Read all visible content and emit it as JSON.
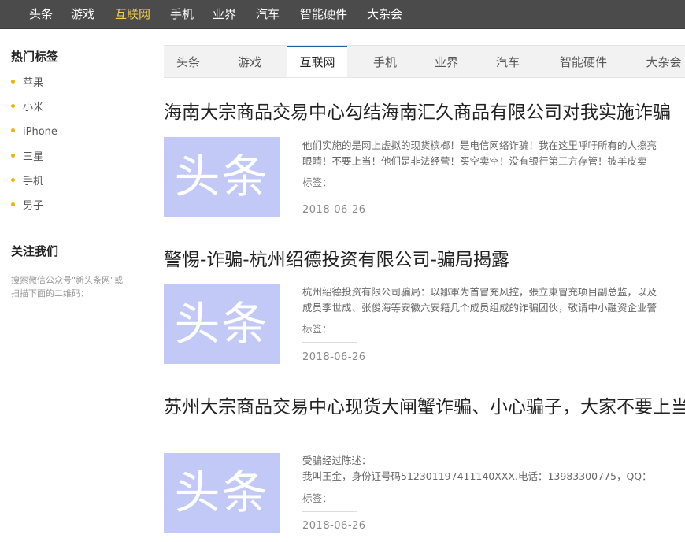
{
  "top_nav": [
    {
      "label": "头条"
    },
    {
      "label": "游戏"
    },
    {
      "label": "互联网",
      "active": true
    },
    {
      "label": "手机"
    },
    {
      "label": "业界"
    },
    {
      "label": "汽车"
    },
    {
      "label": "智能硬件"
    },
    {
      "label": "大杂会"
    }
  ],
  "sidebar": {
    "hot_tags_title": "热门标签",
    "tags": [
      "苹果",
      "小米",
      "iPhone",
      "三星",
      "手机",
      "男子"
    ],
    "follow_title": "关注我们",
    "follow_text": "搜索微信公众号\"新头条网\"或扫描下面的二维码："
  },
  "tabs": [
    {
      "label": "头条"
    },
    {
      "label": "游戏"
    },
    {
      "label": "互联网",
      "active": true
    },
    {
      "label": "手机"
    },
    {
      "label": "业界"
    },
    {
      "label": "汽车"
    },
    {
      "label": "智能硬件"
    },
    {
      "label": "大杂会"
    }
  ],
  "articles": [
    {
      "title": "海南大宗商品交易中心勾结海南汇久商品有限公司对我实施诈骗",
      "thumb_text": "头条",
      "summary_lines": [
        "他们实施的是网上虚拟的现货槟榔！是电信网络诈骗！我在这里呼吁所有的人擦亮",
        "眼睛！不要上当！他们是非法经营！买空卖空！没有银行第三方存管！披羊皮卖"
      ],
      "tags_label": "标签：",
      "date": "2018-06-26"
    },
    {
      "title": "警惕-诈骗-杭州绍德投资有限公司-骗局揭露",
      "thumb_text": "头条",
      "summary_lines": [
        "杭州绍德投资有限公司骗局：以鄒軍为首冒充风控，張立東冒充项目副总监，以及",
        "成员李世成、张俊海等安徽六安籍几个成员组成的诈骗团伙，敬请中小融资企业警"
      ],
      "tags_label": "标签：",
      "date": "2018-06-26"
    },
    {
      "title": "苏州大宗商品交易中心现货大闸蟹诈骗、小心骗子，大家不要上当",
      "thumb_text": "头条",
      "summary_lines": [
        "受骗经过陈述：",
        "我叫王金，身份证号码512301197411140XXX.电话：13983300775，QQ："
      ],
      "tags_label": "标签：",
      "date": "2018-06-26"
    }
  ],
  "colors": {
    "topbar_bg": "#4b4b4b",
    "active_nav": "#f5d24a",
    "tab_active_border": "#1f5fa8",
    "bullet": "#f0b400",
    "thumb_bg": "#c3c9f7"
  }
}
